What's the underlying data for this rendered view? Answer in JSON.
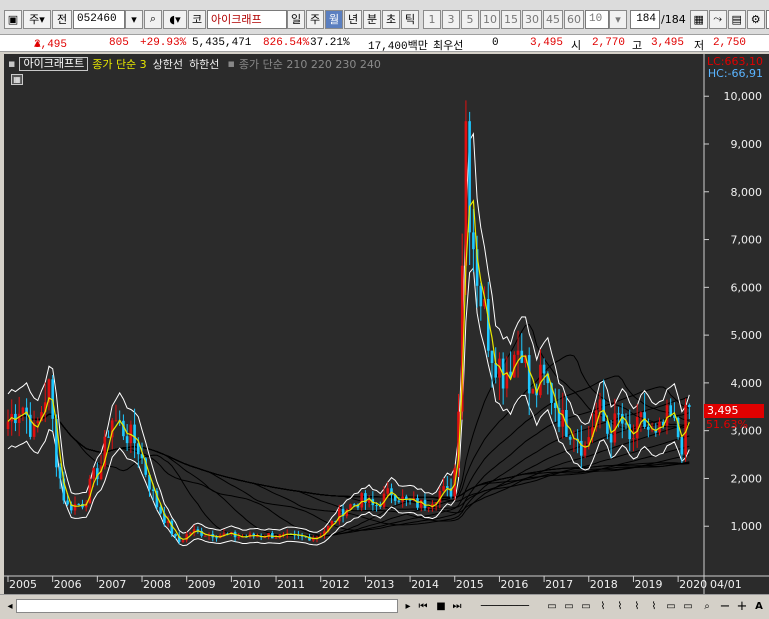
{
  "toolbar": {
    "market": "주",
    "prefix": "전",
    "code": "052460",
    "stock_name": "아이크래프",
    "market_badge": "코",
    "periods": [
      "일",
      "주",
      "월",
      "년",
      "분",
      "초",
      "틱"
    ],
    "selected_period": "월",
    "intervals": [
      "1",
      "3",
      "5",
      "10",
      "15",
      "30",
      "45",
      "60"
    ],
    "interval_value": "10",
    "count": "184",
    "count_total": "/184",
    "right_cut": "20"
  },
  "quote": {
    "price": "3,495",
    "change": "805",
    "change_pct": "+29.93%",
    "volume": "5,435,471",
    "volume_ratio": "826.54%",
    "turnover": "37.21%",
    "amount": "17,400백만",
    "pref_label": "최우선",
    "pref_value": "0",
    "last": "3,495",
    "open_label": "시",
    "open": "2,770",
    "high_label": "고",
    "high": "3,495",
    "low_label": "저",
    "low": "2,750"
  },
  "legend": {
    "name": "아이크래프트",
    "item1": "종가 단순 3",
    "item2": "상한선",
    "item3": "하한선",
    "item4": "종가 단순 210 220 230 240"
  },
  "lc": "LC:663,10",
  "hc": "HC:-66,91",
  "last_tag": "3,495",
  "last_pct": "51.63%",
  "chart_data": {
    "type": "candlestick",
    "yaxis": {
      "ticks": [
        1000,
        2000,
        3000,
        4000,
        5000,
        6000,
        7000,
        8000,
        9000,
        10000
      ],
      "range": [
        0,
        10800
      ]
    },
    "xaxis": {
      "years": [
        "2005",
        "2006",
        "2007",
        "2008",
        "2009",
        "2010",
        "2011",
        "2012",
        "2013",
        "2014",
        "2015",
        "2016",
        "2017",
        "2018",
        "2019",
        "2020"
      ],
      "end_label": "04/01"
    },
    "anchors": [
      [
        2005.0,
        3200
      ],
      [
        2005.3,
        3600
      ],
      [
        2005.6,
        2900
      ],
      [
        2005.9,
        4000
      ],
      [
        2006.1,
        2300
      ],
      [
        2006.3,
        1400
      ],
      [
        2006.7,
        1500
      ],
      [
        2006.9,
        2000
      ],
      [
        2007.1,
        2300
      ],
      [
        2007.3,
        3300
      ],
      [
        2007.5,
        3100
      ],
      [
        2007.9,
        2700
      ],
      [
        2008.3,
        1500
      ],
      [
        2008.6,
        1000
      ],
      [
        2008.8,
        650
      ],
      [
        2009.1,
        900
      ],
      [
        2009.4,
        850
      ],
      [
        2009.8,
        820
      ],
      [
        2010.3,
        780
      ],
      [
        2010.8,
        820
      ],
      [
        2011.3,
        760
      ],
      [
        2011.9,
        780
      ],
      [
        2012.2,
        1000
      ],
      [
        2012.5,
        1350
      ],
      [
        2012.9,
        1550
      ],
      [
        2013.2,
        1400
      ],
      [
        2013.6,
        1750
      ],
      [
        2013.9,
        1500
      ],
      [
        2014.3,
        1450
      ],
      [
        2014.7,
        1750
      ],
      [
        2014.9,
        1650
      ],
      [
        2015.05,
        2500
      ],
      [
        2015.15,
        6200
      ],
      [
        2015.25,
        9500
      ],
      [
        2015.35,
        7500
      ],
      [
        2015.55,
        6000
      ],
      [
        2015.8,
        4800
      ],
      [
        2016.1,
        4200
      ],
      [
        2016.5,
        4900
      ],
      [
        2016.7,
        3600
      ],
      [
        2016.95,
        4100
      ],
      [
        2017.2,
        3700
      ],
      [
        2017.4,
        3200
      ],
      [
        2017.7,
        3000
      ],
      [
        2017.9,
        2600
      ],
      [
        2018.2,
        3500
      ],
      [
        2018.45,
        2900
      ],
      [
        2018.7,
        3300
      ],
      [
        2018.9,
        2700
      ],
      [
        2019.2,
        3200
      ],
      [
        2019.5,
        2800
      ],
      [
        2019.8,
        3300
      ],
      [
        2020.0,
        2900
      ],
      [
        2020.1,
        2700
      ],
      [
        2020.2,
        3495
      ]
    ],
    "last": 3495,
    "moving_average": "종가 단순 3",
    "envelope": [
      "상한선",
      "하한선"
    ],
    "long_ma": [
      210,
      220,
      230,
      240
    ]
  },
  "colors": {
    "up": "#e01010",
    "down": "#1ec8ff",
    "ma3": "#e8e800",
    "envelope": "#ffffff",
    "long_ma": "#000000",
    "bg": "#2b2b2b",
    "axis_text": "#f0f0f0"
  }
}
